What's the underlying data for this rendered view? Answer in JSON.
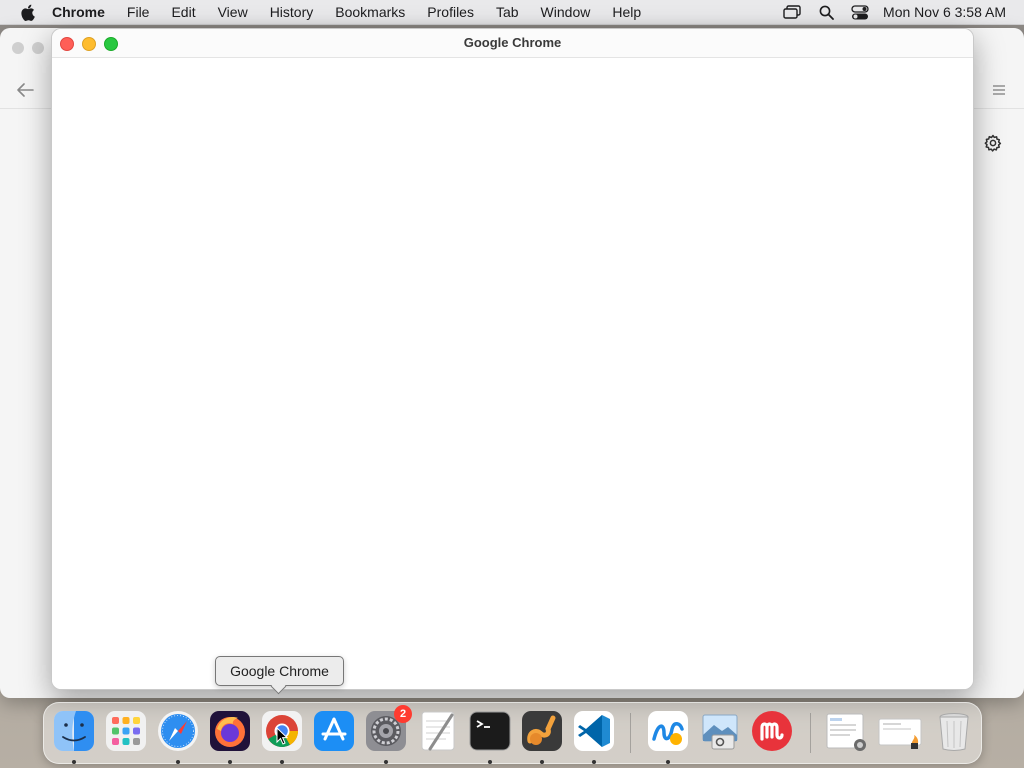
{
  "menubar": {
    "app_name": "Chrome",
    "items": [
      "File",
      "Edit",
      "View",
      "History",
      "Bookmarks",
      "Profiles",
      "Tab",
      "Window",
      "Help"
    ],
    "clock": "Mon Nov 6  3:58 AM"
  },
  "window": {
    "title": "Google Chrome"
  },
  "tooltip": {
    "text": "Google Chrome"
  },
  "dock": {
    "items": [
      {
        "name": "Finder",
        "icon": "finder-icon"
      },
      {
        "name": "Launchpad",
        "icon": "launchpad-icon"
      },
      {
        "name": "Safari",
        "icon": "safari-icon"
      },
      {
        "name": "Firefox",
        "icon": "firefox-icon"
      },
      {
        "name": "Google Chrome",
        "icon": "chrome-icon"
      },
      {
        "name": "App Store",
        "icon": "app-store-icon"
      },
      {
        "name": "System Settings",
        "icon": "system-settings-icon",
        "badge": "2"
      },
      {
        "name": "TextEdit",
        "icon": "textedit-icon"
      },
      {
        "name": "Terminal",
        "icon": "terminal-icon"
      },
      {
        "name": "Instruments",
        "icon": "instruments-icon"
      },
      {
        "name": "Visual Studio Code",
        "icon": "vscode-icon"
      },
      {
        "name": "Freeform",
        "icon": "freeform-icon"
      },
      {
        "name": "Preview",
        "icon": "preview-icon"
      },
      {
        "name": "Mastodon",
        "icon": "mastodon-icon"
      },
      {
        "name": "Downloads",
        "icon": "downloads-stack-icon"
      },
      {
        "name": "Documents",
        "icon": "documents-stack-icon"
      },
      {
        "name": "Trash",
        "icon": "trash-icon"
      }
    ]
  },
  "colors": {
    "close": "#ff5f57",
    "minimize": "#febc2e",
    "maximize": "#28c840",
    "badge": "#ff3b30"
  }
}
